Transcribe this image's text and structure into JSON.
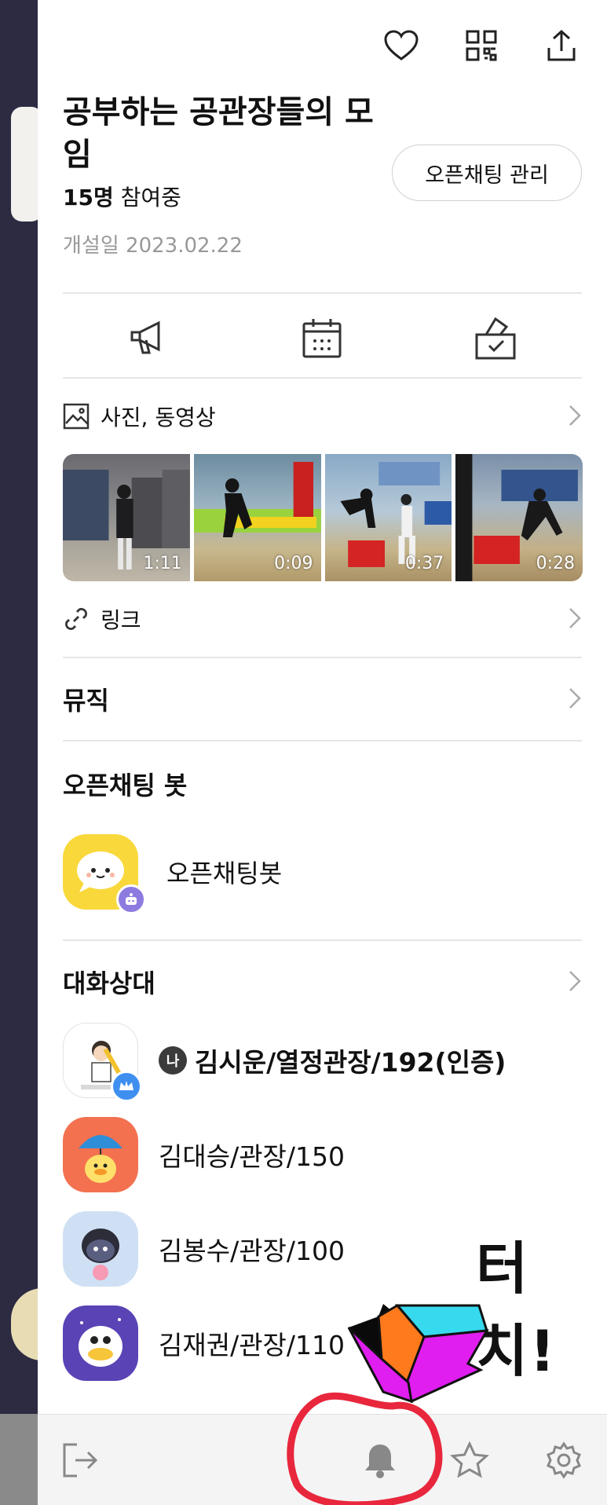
{
  "room": {
    "title": "공부하는 공관장들의 모임",
    "members_count": "15명",
    "members_suffix": " 참여중",
    "opened_date": "개설일 2023.02.22",
    "manage_label": "오픈채팅 관리"
  },
  "top_icons": [
    "heart-icon",
    "qr-code-icon",
    "share-icon"
  ],
  "quick_icons": [
    "megaphone-icon",
    "calendar-icon",
    "vote-box-icon"
  ],
  "media": {
    "label": "사진, 동영상",
    "videos": [
      {
        "duration": "1:11"
      },
      {
        "duration": "0:09"
      },
      {
        "duration": "0:37"
      },
      {
        "duration": "0:28"
      }
    ]
  },
  "links": {
    "label": "링크"
  },
  "music": {
    "label": "뮤직"
  },
  "bot_section": {
    "title": "오픈채팅 봇",
    "bot_name": "오픈채팅봇"
  },
  "members_section": {
    "title": "대화상대",
    "me_badge": "나",
    "members": [
      {
        "name": "김시운/열정관장/192(인증)"
      },
      {
        "name": "김대승/관장/150"
      },
      {
        "name": "김봉수/관장/100"
      },
      {
        "name": "김재권/관장/110"
      }
    ]
  },
  "annotation": {
    "touch_text": "터치!"
  },
  "bottom_bar": [
    "exit-icon",
    "bell-icon",
    "star-icon",
    "settings-icon"
  ],
  "colors": {
    "background": "#2b2a3f",
    "panel": "#ffffff",
    "annotation_circle": "#e8273d",
    "arrow_magenta": "#e01ef0",
    "arrow_cyan": "#37d9ee",
    "arrow_orange": "#ff7a1c"
  }
}
